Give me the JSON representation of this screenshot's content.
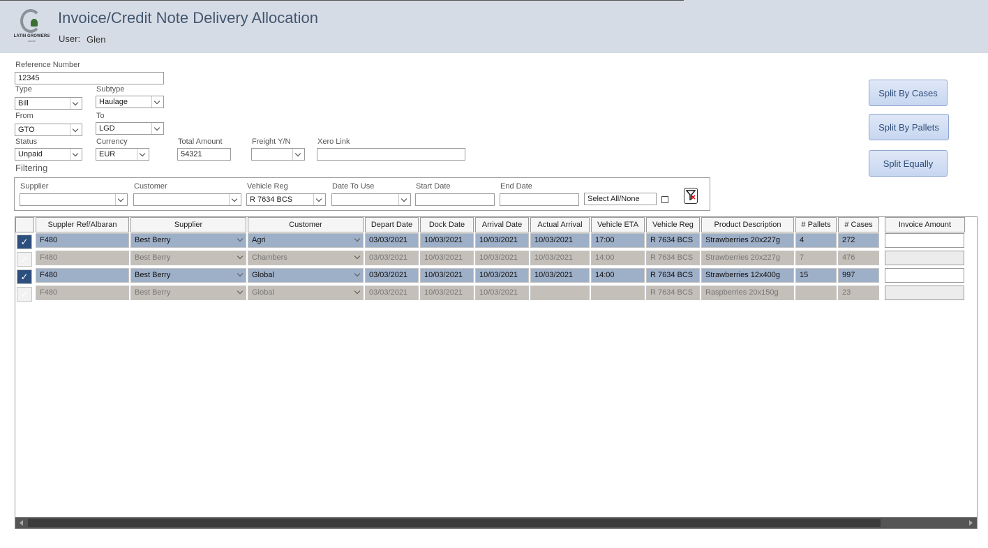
{
  "header": {
    "title": "Invoice/Credit Note Delivery Allocation",
    "user_label": "User:",
    "user_name": "Glen",
    "logo_text": "LATIN GROWERS",
    "logo_sub": "GROUP"
  },
  "form": {
    "reference_label": "Reference Number",
    "reference_value": "12345",
    "type_label": "Type",
    "type_value": "Bill",
    "subtype_label": "Subtype",
    "subtype_value": "Haulage",
    "from_label": "From",
    "from_value": "GTO",
    "to_label": "To",
    "to_value": "LGD",
    "status_label": "Status",
    "status_value": "Unpaid",
    "currency_label": "Currency",
    "currency_value": "EUR",
    "total_label": "Total Amount",
    "total_value": "54321",
    "freight_label": "Freight Y/N",
    "freight_value": "",
    "xero_label": "Xero Link",
    "xero_value": ""
  },
  "buttons": {
    "split_cases": "Split By Cases",
    "split_pallets": "Split By Pallets",
    "split_equally": "Split Equally"
  },
  "filtering": {
    "heading": "Filtering",
    "supplier_label": "Supplier",
    "supplier_value": "",
    "customer_label": "Customer",
    "customer_value": "",
    "vehicle_label": "Vehicle Reg",
    "vehicle_value": "R 7634 BCS",
    "date_to_use_label": "Date To Use",
    "date_to_use_value": "",
    "start_label": "Start Date",
    "start_value": "",
    "end_label": "End Date",
    "end_value": "",
    "select_all": "Select All/None",
    "clear_icon": "filter-clear-icon"
  },
  "grid": {
    "headers": [
      "Suppler Ref/Albaran",
      "Supplier",
      "Customer",
      "Depart Date",
      "Dock Date",
      "Arrival Date",
      "Actual Arrival",
      "Vehicle ETA",
      "Vehicle Reg",
      "Product Description",
      "# Pallets",
      "# Cases",
      "Invoice Amount"
    ],
    "rows": [
      {
        "selected": true,
        "check": "✓",
        "ref": "F480",
        "supplier": "Best Berry",
        "customer": "Agri",
        "depart": "03/03/2021",
        "dock": "10/03/2021",
        "arrival": "10/03/2021",
        "actual": "10/03/2021",
        "eta": "17:00",
        "reg": "R 7634 BCS",
        "product": "Strawberries 20x227g",
        "pallets": "4",
        "cases": "272",
        "amount": ""
      },
      {
        "selected": false,
        "check": "✓",
        "ref": "F480",
        "supplier": "Best Berry",
        "customer": "Chambers",
        "depart": "03/03/2021",
        "dock": "10/03/2021",
        "arrival": "10/03/2021",
        "actual": "10/03/2021",
        "eta": "14:00",
        "reg": "R 7634 BCS",
        "product": "Strawberries 20x227g",
        "pallets": "7",
        "cases": "476",
        "amount": ""
      },
      {
        "selected": true,
        "check": "✓",
        "ref": "F480",
        "supplier": "Best Berry",
        "customer": "Global",
        "depart": "03/03/2021",
        "dock": "10/03/2021",
        "arrival": "10/03/2021",
        "actual": "10/03/2021",
        "eta": "14:00",
        "reg": "R 7634 BCS",
        "product": "Strawberries 12x400g",
        "pallets": "15",
        "cases": "997",
        "amount": ""
      },
      {
        "selected": false,
        "check": "✓",
        "ref": "F480",
        "supplier": "Best Berry",
        "customer": "Global",
        "depart": "03/03/2021",
        "dock": "10/03/2021",
        "arrival": "10/03/2021",
        "actual": "",
        "eta": "",
        "reg": "R 7634 BCS",
        "product": "Raspberries 20x150g",
        "pallets": "",
        "cases": "23",
        "amount": ""
      }
    ]
  }
}
